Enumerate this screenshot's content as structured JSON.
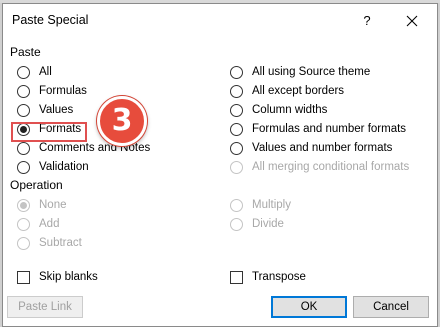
{
  "dialog": {
    "title": "Paste Special",
    "help_label": "?",
    "close_label": "close"
  },
  "paste": {
    "label": "Paste",
    "options_left": [
      {
        "label": "All",
        "checked": false,
        "enabled": true
      },
      {
        "label": "Formulas",
        "checked": false,
        "enabled": true
      },
      {
        "label": "Values",
        "checked": false,
        "enabled": true
      },
      {
        "label": "Formats",
        "checked": true,
        "enabled": true
      },
      {
        "label": "Comments and Notes",
        "checked": false,
        "enabled": true
      },
      {
        "label": "Validation",
        "checked": false,
        "enabled": true
      }
    ],
    "options_right": [
      {
        "label": "All using Source theme",
        "checked": false,
        "enabled": true
      },
      {
        "label": "All except borders",
        "checked": false,
        "enabled": true
      },
      {
        "label": "Column widths",
        "checked": false,
        "enabled": true
      },
      {
        "label": "Formulas and number formats",
        "checked": false,
        "enabled": true
      },
      {
        "label": "Values and number formats",
        "checked": false,
        "enabled": true
      },
      {
        "label": "All merging conditional formats",
        "checked": false,
        "enabled": false
      }
    ]
  },
  "operation": {
    "label": "Operation",
    "options_left": [
      {
        "label": "None",
        "checked": true,
        "enabled": false
      },
      {
        "label": "Add",
        "checked": false,
        "enabled": false
      },
      {
        "label": "Subtract",
        "checked": false,
        "enabled": false
      }
    ],
    "options_right": [
      {
        "label": "Multiply",
        "checked": false,
        "enabled": false
      },
      {
        "label": "Divide",
        "checked": false,
        "enabled": false
      }
    ]
  },
  "checkboxes": {
    "skip_blanks": "Skip blanks",
    "transpose": "Transpose"
  },
  "buttons": {
    "paste_link": "Paste Link",
    "ok": "OK",
    "cancel": "Cancel"
  },
  "annotation": {
    "step_number": "3",
    "badge_color": "#e74c3c",
    "highlight_color": "#e05050"
  }
}
